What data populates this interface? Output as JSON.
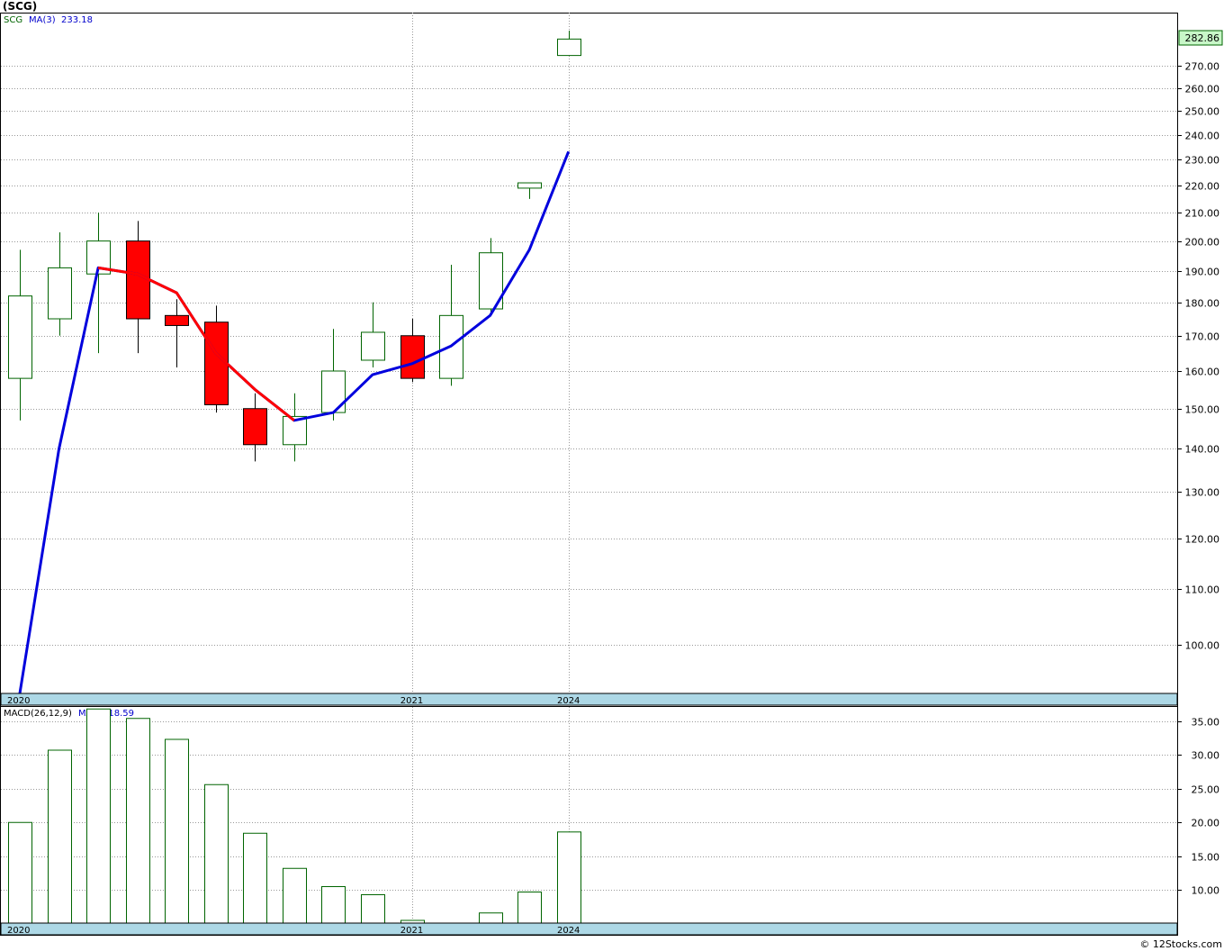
{
  "header": {
    "symbol": "(SCG)",
    "series_tag": "SCG",
    "ma_label": "MA(3)",
    "ma_value": "233.18",
    "macd_label": "MACD(26,12,9)",
    "macd_value": "MACD:18.59",
    "last_price": "282.86",
    "watermark": "© 12Stocks.com"
  },
  "colors": {
    "up": "#006400",
    "down": "#ff0000",
    "ma_line_main": "#0000dd",
    "ma_line_down": "#ff0000",
    "axis_band": "#add8e6",
    "price_tag_bg": "#c8f7c8",
    "grid": "#999999"
  },
  "chart_data": [
    {
      "type": "candlestick",
      "title": "(SCG)",
      "x_labels": [
        {
          "index": 0,
          "label": "2020"
        },
        {
          "index": 10,
          "label": "2021"
        },
        {
          "index": 14,
          "label": "2024"
        }
      ],
      "y_ticks": [
        100,
        110,
        120,
        130,
        140,
        150,
        160,
        170,
        180,
        190,
        200,
        210,
        220,
        230,
        240,
        250,
        260,
        270
      ],
      "y_tick_labels": [
        "100.00",
        "110.00",
        "120.00",
        "130.00",
        "140.00",
        "150.00",
        "160.00",
        "170.00",
        "180.00",
        "190.00",
        "200.00",
        "210.00",
        "220.00",
        "230.00",
        "240.00",
        "250.00",
        "260.00",
        "270.00"
      ],
      "y_scale": "log",
      "ylim": [
        92,
        296
      ],
      "grid": true,
      "candles": [
        {
          "open": 158,
          "high": 197,
          "low": 147,
          "close": 182
        },
        {
          "open": 175,
          "high": 203,
          "low": 170,
          "close": 191
        },
        {
          "open": 189,
          "high": 210,
          "low": 165,
          "close": 200
        },
        {
          "open": 200,
          "high": 207,
          "low": 165,
          "close": 175
        },
        {
          "open": 176,
          "high": 181,
          "low": 161,
          "close": 173
        },
        {
          "open": 174,
          "high": 179,
          "low": 149,
          "close": 151
        },
        {
          "open": 150,
          "high": 154,
          "low": 137,
          "close": 141
        },
        {
          "open": 141,
          "high": 154,
          "low": 137,
          "close": 148
        },
        {
          "open": 149,
          "high": 172,
          "low": 147,
          "close": 160
        },
        {
          "open": 163,
          "high": 180,
          "low": 161,
          "close": 171
        },
        {
          "open": 170,
          "high": 175,
          "low": 157,
          "close": 158
        },
        {
          "open": 158,
          "high": 192,
          "low": 156,
          "close": 176
        },
        {
          "open": 178,
          "high": 201,
          "low": 176,
          "close": 196
        },
        {
          "open": 219,
          "high": 221,
          "low": 215,
          "close": 221
        },
        {
          "open": 275,
          "high": 287,
          "low": 275,
          "close": 282.86
        }
      ],
      "ma_series": {
        "name": "MA(3)",
        "values": [
          92,
          140,
          191,
          189,
          183,
          165,
          155,
          147,
          149,
          159,
          162,
          167,
          176,
          197,
          233.18
        ],
        "down_segments": [
          [
            2,
            7
          ]
        ]
      }
    },
    {
      "type": "bar",
      "title": "MACD(26,12,9)",
      "x_labels": [
        {
          "index": 0,
          "label": "2020"
        },
        {
          "index": 10,
          "label": "2021"
        },
        {
          "index": 14,
          "label": "2024"
        }
      ],
      "y_ticks": [
        10,
        15,
        20,
        25,
        30,
        35
      ],
      "y_tick_labels": [
        "10.00",
        "15.00",
        "20.00",
        "25.00",
        "30.00",
        "35.00"
      ],
      "ylim": [
        5.1,
        37.1
      ],
      "values": [
        20,
        30.7,
        36.8,
        35.4,
        32.3,
        25.6,
        18.4,
        13.2,
        10.5,
        9.3,
        5.5,
        5.0,
        6.6,
        9.7,
        18.59
      ]
    }
  ]
}
